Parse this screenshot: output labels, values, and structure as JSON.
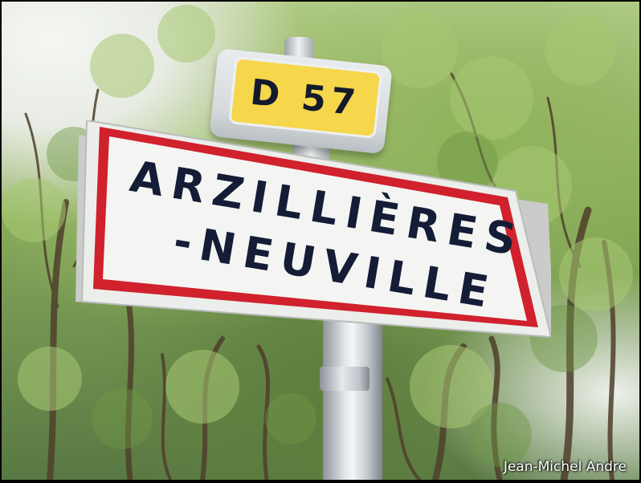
{
  "route_sign": {
    "text": "D 57",
    "background": "#f6d64a",
    "text_color": "#141a2c"
  },
  "town_sign": {
    "line1": "ARZILLIÈRES",
    "line2": "-NEUVILLE",
    "border_color": "#d0212d",
    "background": "#f4f5f3",
    "text_color": "#141c36"
  },
  "watermark": "Jean-Michel Andre"
}
